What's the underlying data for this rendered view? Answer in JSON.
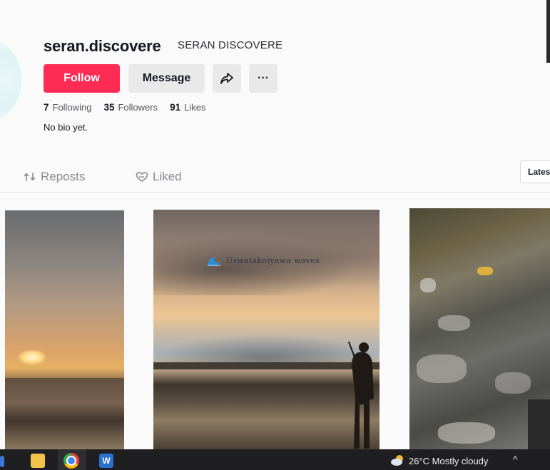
{
  "profile": {
    "username": "seran.discovere",
    "nickname": "SERAN DISCOVERE",
    "follow_label": "Follow",
    "message_label": "Message",
    "share_icon": "share-icon",
    "more_label": "···",
    "stats": [
      {
        "value": "7",
        "label": "Following"
      },
      {
        "value": "35",
        "label": "Followers"
      },
      {
        "value": "91",
        "label": "Likes"
      }
    ],
    "bio": "No bio yet."
  },
  "tabs": [
    {
      "label": "Reposts",
      "icon": "repost-icon"
    },
    {
      "label": "Liked",
      "icon": "heart-outline-icon"
    }
  ],
  "sort": {
    "label": "Lates"
  },
  "videos": [
    {
      "watermark": ""
    },
    {
      "watermark": "Uswatakeiyawa waves"
    },
    {
      "watermark": ""
    }
  ],
  "taskbar": {
    "word_label": "W",
    "weather": "26°C  Mostly cloudy",
    "chevron": "^"
  },
  "colors": {
    "follow": "#fe2c55",
    "secondary_button": "#e9e9ea",
    "taskbar": "#1f1f22"
  }
}
